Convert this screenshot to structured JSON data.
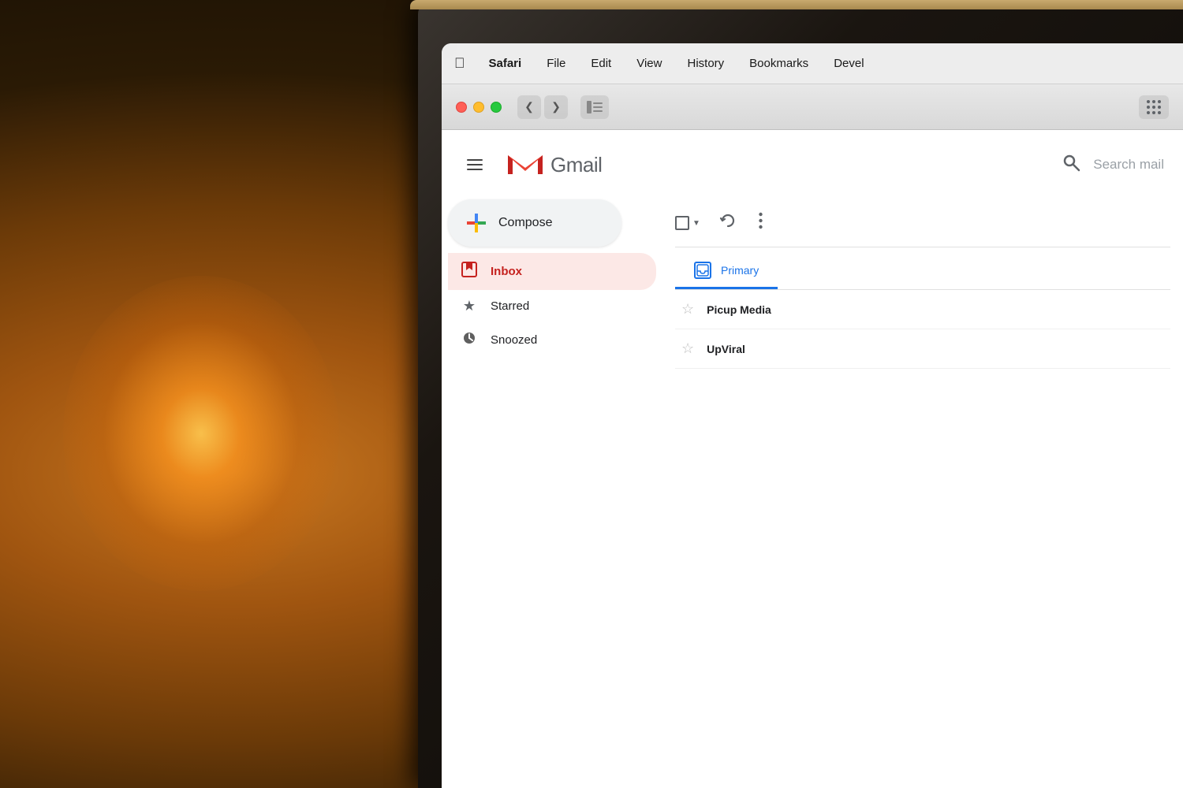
{
  "background": {
    "description": "Warm bokeh photo background with lamp/candle glow"
  },
  "laptop": {
    "bezel_color": "#2a2015",
    "edge_color": "#c8a96e"
  },
  "menubar": {
    "apple_symbol": "",
    "items": [
      "Safari",
      "File",
      "Edit",
      "View",
      "History",
      "Bookmarks",
      "Devel"
    ]
  },
  "safari_toolbar": {
    "traffic_lights": {
      "red": "#ff5f56",
      "yellow": "#ffbd2e",
      "green": "#27c93f"
    },
    "back_btn": "‹",
    "forward_btn": "›"
  },
  "gmail": {
    "logo_letter": "M",
    "app_name": "Gmail",
    "search_placeholder": "Search mail",
    "compose_label": "Compose",
    "nav_items": [
      {
        "id": "inbox",
        "label": "Inbox",
        "icon": "inbox",
        "active": true
      },
      {
        "id": "starred",
        "label": "Starred",
        "icon": "star",
        "active": false
      },
      {
        "id": "snoozed",
        "label": "Snoozed",
        "icon": "clock",
        "active": false
      }
    ],
    "tabs": [
      {
        "id": "primary",
        "label": "Primary",
        "active": false
      }
    ],
    "emails": [
      {
        "sender": "Picup Media",
        "starred": false
      },
      {
        "sender": "UpViral",
        "starred": false
      }
    ]
  }
}
